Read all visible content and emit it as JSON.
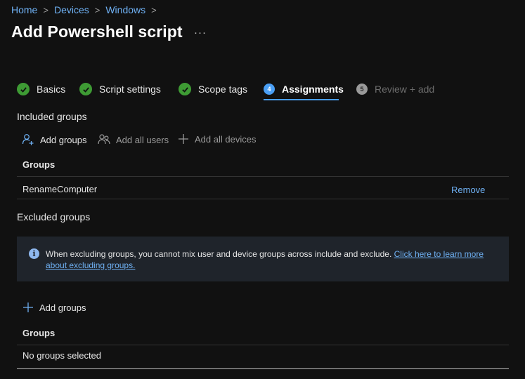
{
  "breadcrumb": [
    "Home",
    "Devices",
    "Windows"
  ],
  "page_title": "Add Powershell script",
  "more_label": "···",
  "steps": [
    {
      "label": "Basics",
      "state": "complete"
    },
    {
      "label": "Script settings",
      "state": "complete"
    },
    {
      "label": "Scope tags",
      "state": "complete"
    },
    {
      "label": "Assignments",
      "state": "active",
      "number": "4"
    },
    {
      "label": "Review + add",
      "state": "disabled",
      "number": "5"
    }
  ],
  "included": {
    "title": "Included groups",
    "commands": {
      "add_groups": "Add groups",
      "add_all_users": "Add all users",
      "add_all_devices": "Add all devices"
    },
    "column_header": "Groups",
    "rows": [
      {
        "name": "RenameComputer",
        "action": "Remove"
      }
    ]
  },
  "excluded": {
    "title": "Excluded groups",
    "info_text": "When excluding groups, you cannot mix user and device groups across include and exclude. ",
    "info_link": "Click here to learn more about excluding groups.",
    "add_groups": "Add groups",
    "column_header": "Groups",
    "empty_text": "No groups selected"
  },
  "colors": {
    "accent": "#4a9ff5",
    "link": "#6fb1f4",
    "success": "#3e9b34",
    "background": "#111111"
  }
}
